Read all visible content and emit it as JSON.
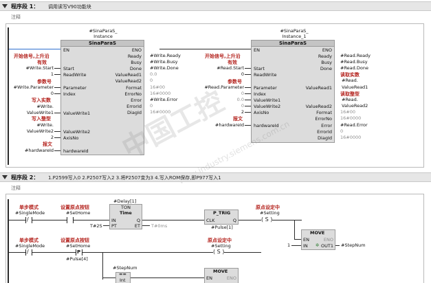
{
  "segment1": {
    "title": "程序段 1：",
    "desc": "调用读写V90功能块",
    "comment_label": "注释",
    "block_left": {
      "instance_line1": "#SinaParaS_",
      "instance_line2": "Instance",
      "name": "SinaParaS",
      "en": "EN",
      "eno": "ENO",
      "pins_left": [
        "Start",
        "ReadWrite",
        "Parameter",
        "Index",
        "ValueWrite1",
        "ValueWrite2",
        "AxisNo",
        "hardwareId"
      ],
      "pins_right": [
        "Ready",
        "Busy",
        "Done",
        "ValueRead1",
        "ValueRead2",
        "Format",
        "ErrorNo",
        "Error",
        "ErrorId",
        "DiagId"
      ],
      "inputs": [
        "#Write.Start",
        "1",
        "#Write.Parameter",
        "0",
        "#Write.\nValueWrite1",
        "#Write.\nValueWrite2",
        "2",
        "#hardwareId"
      ],
      "outputs": [
        "#Write.Ready",
        "#Write.Busy",
        "#Write.Done",
        "0.0",
        "0",
        "16#00",
        "16#0000",
        "#Write.Error",
        "0",
        "16#0000"
      ],
      "labels": [
        "开始信号,上升沿",
        "有效",
        "参数号",
        "写入实数",
        "写入整型",
        "报文"
      ]
    },
    "block_right": {
      "instance_line1": "#SinaParaS_",
      "instance_line2": "Instance_1",
      "name": "SinaParaS",
      "en": "EN",
      "eno": "ENO",
      "pins_left": [
        "Start",
        "ReadWrite",
        "Parameter",
        "Index",
        "ValueWrite1",
        "ValueWrite2",
        "AxisNo",
        "hardwareId"
      ],
      "pins_right": [
        "Ready",
        "Busy",
        "Done",
        "ValueRead1",
        "ValueRead2",
        "Format",
        "ErrorNo",
        "Error",
        "ErrorId",
        "DiagId"
      ],
      "inputs": [
        "#Read.Start",
        "0",
        "#Read.Parameter",
        "0",
        "0.0",
        "0",
        "2",
        "#hardwareId"
      ],
      "outputs": [
        "#Read.Ready",
        "#Read.Busy",
        "#Read.Done",
        "#Read.\nValueRead1",
        "#Read.\nValueRead2",
        "16#00",
        "16#0000",
        "#Read.Error",
        "0",
        "16#0000"
      ],
      "labels": [
        "开始信号,上升沿",
        "有效",
        "参数号",
        "报文",
        "读取实数",
        "读取整型"
      ]
    }
  },
  "segment2": {
    "title": "程序段 2：",
    "desc": "1.P2599写入0   2.P2507写入2  3.将P2507变为3  4.写入ROM保存,即P977写入1",
    "comment_label": "注释",
    "row1": {
      "contact1_label": "单步模式",
      "contact1_tag": "#SingleMode",
      "contact2_label": "设置原点按钮",
      "contact2_tag": "#SetHome",
      "ton_instance": "#Delay[1]",
      "ton_type": "TON",
      "ton_sub": "Time",
      "ton_in": "IN",
      "ton_q": "Q",
      "ton_pt": "PT",
      "ton_et": "ET",
      "pt_value": "T#2S",
      "et_value": "T#0ms",
      "ptrig_name": "P_TRIG",
      "ptrig_clk": "CLK",
      "ptrig_q": "Q",
      "ptrig_tag": "#Pulse[1]",
      "coil_label": "原点设定中",
      "coil_tag": "#Setting",
      "coil_symbol": "( S )",
      "move_name": "MOVE",
      "move_en": "EN",
      "move_eno": "ENO",
      "move_in": "IN",
      "move_out": "OUT1",
      "move_in_value": "1",
      "move_out_tag": "#StepNum"
    },
    "row2": {
      "contact1_label": "单步模式",
      "contact1_tag": "#SingleMode",
      "contact2_label": "设置原点按钮",
      "contact2_tag": "#SetHome",
      "contact2_pulse": "#Pulse[4]",
      "contact2_p": "P",
      "coil_label": "原点设定中",
      "coil_tag": "#Setting",
      "coil_symbol": "( S )"
    },
    "row3": {
      "step_tag": "#StepNum",
      "cmp_label": "==",
      "cmp_type": "Int",
      "move_name": "MOVE",
      "move_en": "EN",
      "move_eno": "ENO"
    }
  },
  "watermark": {
    "text": "中国工控",
    "sub": "www.industry.siemens.com.cn"
  }
}
